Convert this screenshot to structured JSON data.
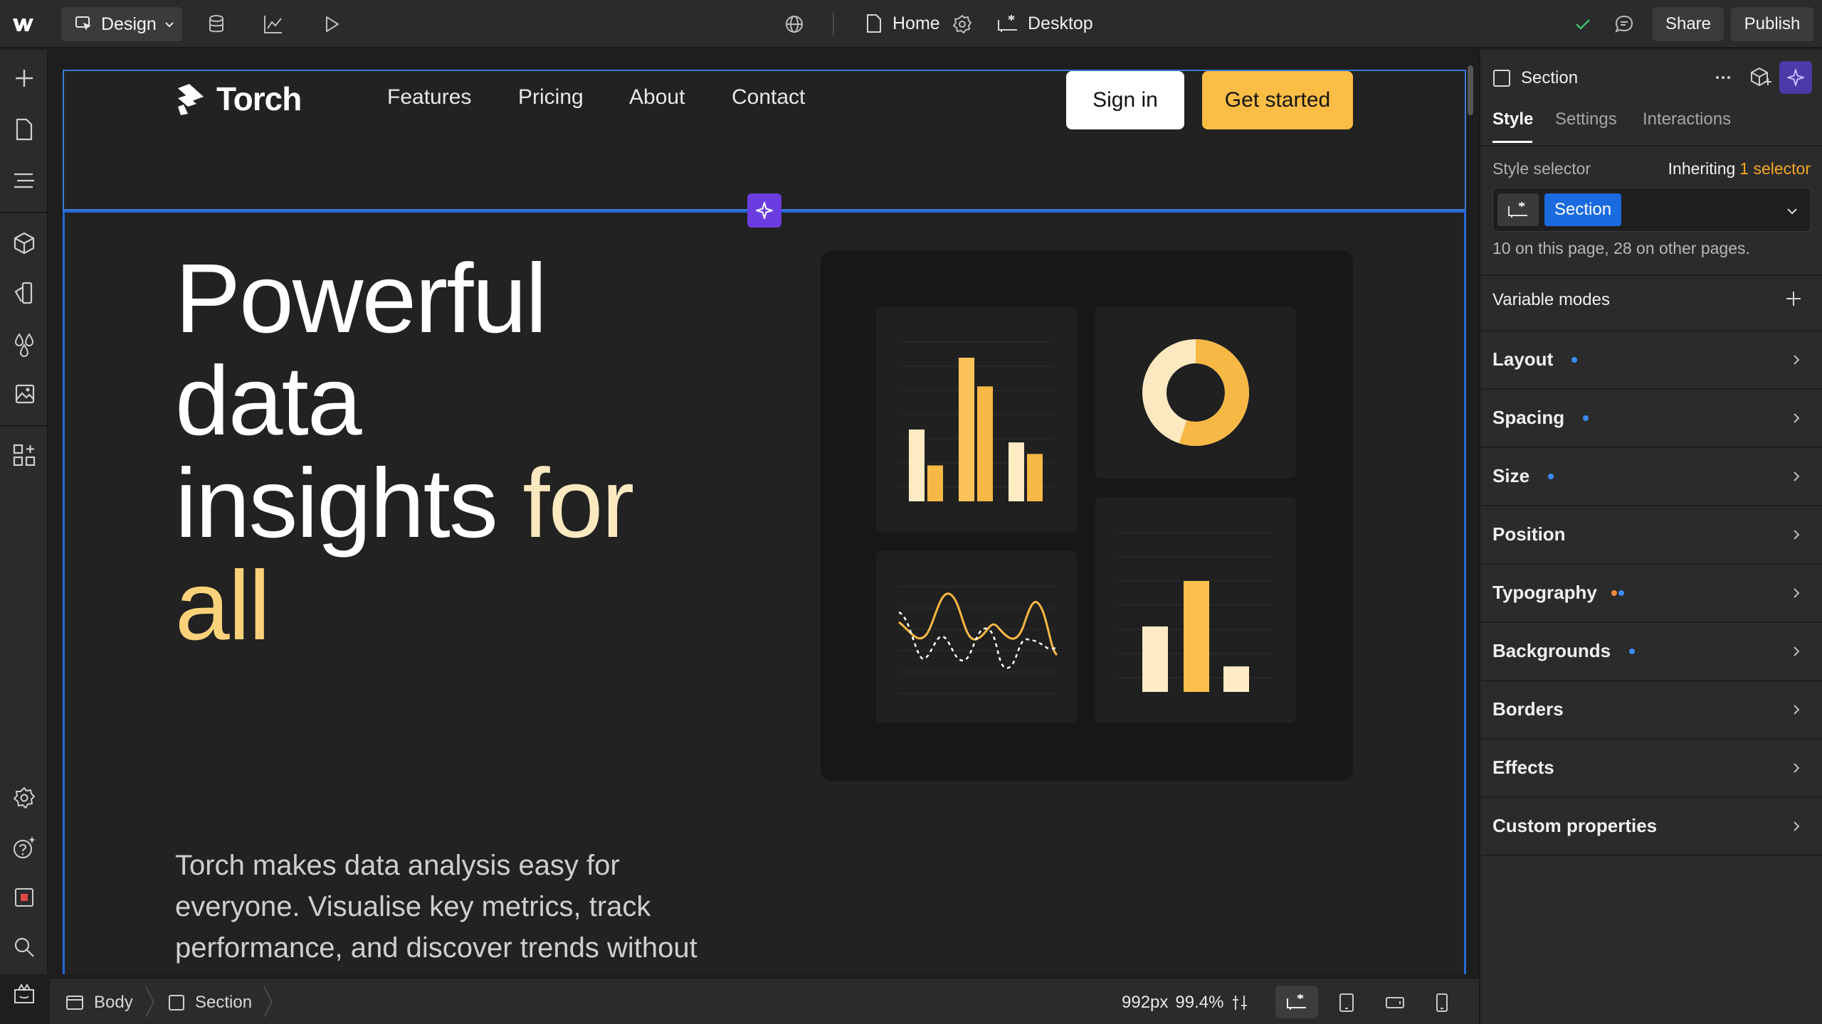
{
  "topbar": {
    "mode_label": "Design",
    "page_name": "Home",
    "breakpoint": "Desktop",
    "share_label": "Share",
    "publish_label": "Publish"
  },
  "site": {
    "brand": "Torch",
    "nav": [
      "Features",
      "Pricing",
      "About",
      "Contact"
    ],
    "signin_label": "Sign in",
    "cta_label": "Get started",
    "headline_1": "Powerful",
    "headline_2": "data",
    "headline_3a": "insights ",
    "headline_3b": "for",
    "headline_4": "all",
    "subcopy": "Torch makes data analysis easy for everyone. Visualise key metrics, track performance, and discover trends without",
    "colors": {
      "accent": "#fbbd45",
      "accent_light": "#fde9c0",
      "background": "#222222"
    }
  },
  "dashboard_widgets": {
    "bar_chart_1": [
      0.5,
      0.25,
      1.0,
      0.8,
      0.41,
      0.33
    ],
    "bar_colors_1": [
      "#fdebc4",
      "#f7b845",
      "#fbc35a",
      "#f7b845",
      "#fdebc4",
      "#f7b845"
    ],
    "donut_fraction_highlight": 0.55,
    "bar_chart_2": [
      0.59,
      1.0,
      0.23
    ],
    "bar_colors_2": [
      "#fdebc4",
      "#fbc04e",
      "#fdebc4"
    ]
  },
  "panel": {
    "element_name": "Section",
    "tabs": [
      "Style",
      "Settings",
      "Interactions"
    ],
    "style_selector_label": "Style selector",
    "inheriting_label": "Inheriting",
    "inheriting_link": "1 selector",
    "selector_chip": "Section",
    "usage_text": "10 on this page, 28 on other pages.",
    "variable_modes": "Variable modes",
    "properties": [
      {
        "label": "Layout",
        "dot": "blue"
      },
      {
        "label": "Spacing",
        "dot": "blue"
      },
      {
        "label": "Size",
        "dot": "blue"
      },
      {
        "label": "Position",
        "dot": ""
      },
      {
        "label": "Typography",
        "dot": "mixed"
      },
      {
        "label": "Backgrounds",
        "dot": "blue"
      },
      {
        "label": "Borders",
        "dot": ""
      },
      {
        "label": "Effects",
        "dot": ""
      },
      {
        "label": "Custom properties",
        "dot": ""
      }
    ]
  },
  "bottombar": {
    "breadcrumb": [
      "Body",
      "Section"
    ],
    "width_readout": "992px",
    "zoom_readout": "99.4%"
  }
}
